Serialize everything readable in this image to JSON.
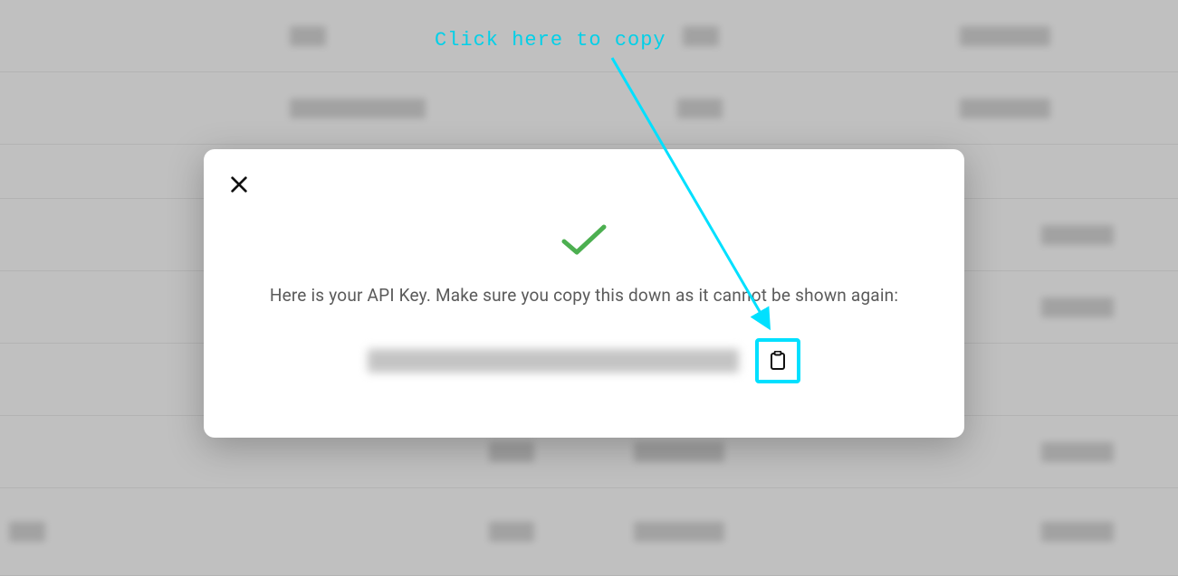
{
  "annotation": {
    "label": "Click here to copy"
  },
  "modal": {
    "message": "Here is your API Key. Make sure you copy this down as it cannot be shown again:"
  }
}
